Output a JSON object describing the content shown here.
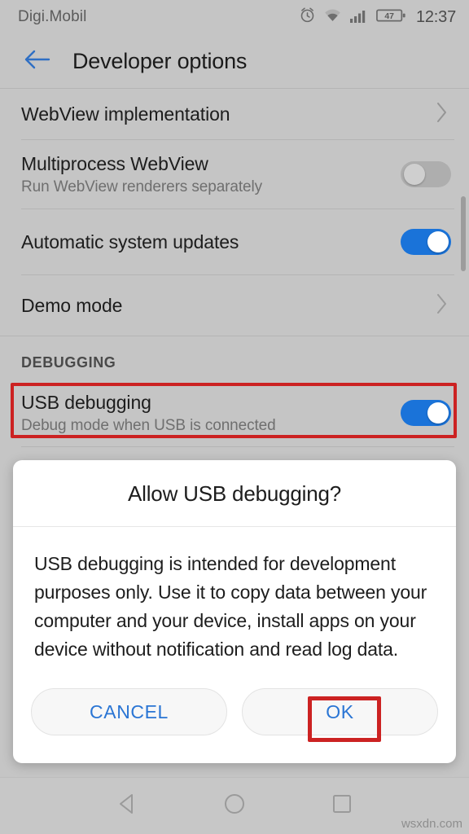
{
  "status_bar": {
    "carrier": "Digi.Mobil",
    "clock": "12:37",
    "battery_level": "47",
    "icons": [
      "alarm-icon",
      "wifi-icon",
      "signal-icon",
      "battery-icon"
    ]
  },
  "app_bar": {
    "back_icon": "back-arrow-icon",
    "title": "Developer options"
  },
  "settings": {
    "rows": [
      {
        "title": "WebView implementation",
        "subtitle": "",
        "control": "chevron"
      },
      {
        "title": "Multiprocess WebView",
        "subtitle": "Run WebView renderers separately",
        "control": "switch-off"
      },
      {
        "title": "Automatic system updates",
        "subtitle": "",
        "control": "switch-on"
      },
      {
        "title": "Demo mode",
        "subtitle": "",
        "control": "chevron"
      }
    ],
    "section_header": "DEBUGGING",
    "usb_row": {
      "title": "USB debugging",
      "subtitle": "Debug mode when USB is connected",
      "control": "switch-on"
    }
  },
  "dialog": {
    "title": "Allow USB debugging?",
    "body": "USB debugging is intended for development purposes only. Use it to copy data between your computer and your device, install apps on your device without notification and read log data.",
    "cancel_label": "CANCEL",
    "ok_label": "OK"
  },
  "nav_bar": {
    "back_icon": "nav-back-triangle-icon",
    "home_icon": "nav-home-circle-icon",
    "recents_icon": "nav-recents-square-icon"
  },
  "watermark": "wsxdn.com",
  "colors": {
    "background": "#c5c5c5",
    "accent_blue": "#1a73d9",
    "link_blue": "#2a75d4",
    "annotation_red": "#cc2222",
    "dialog_bg": "#ffffff"
  }
}
